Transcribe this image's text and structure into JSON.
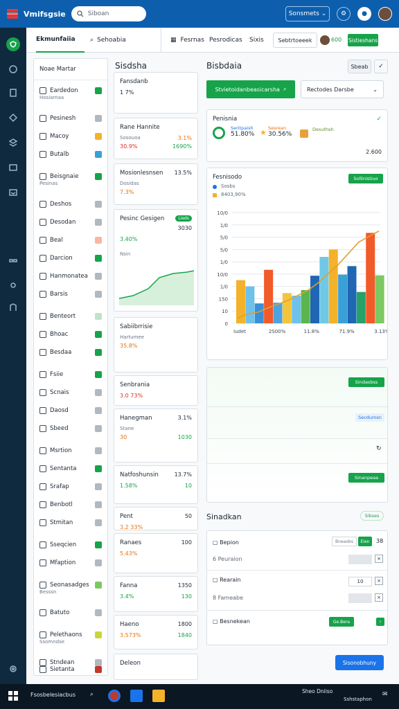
{
  "app": {
    "title": "Vmifsgsie",
    "search_placeholder": "Siboan",
    "btn_label": "Sonsmets"
  },
  "tabs": [
    {
      "label": "Ekmunfaiia"
    },
    {
      "label": "Sehoabia"
    }
  ],
  "toolbar": {
    "items": [
      "Fesrnas",
      "Pesrodicas",
      "Sixis"
    ],
    "select": "Sebtrtoeeek",
    "count": "600",
    "green_btn": "Sistieshans"
  },
  "left_list": {
    "header": "Noae Martar",
    "items": [
      {
        "label": "Eardedon",
        "sub": "Hosiarnaa"
      },
      {
        "label": "Pesinesh"
      },
      {
        "label": "Macoy"
      },
      {
        "label": "Butalb"
      },
      {
        "label": "Beisgnaie",
        "sub": "Pesinas"
      },
      {
        "label": "Deshos"
      },
      {
        "label": "Desodan"
      },
      {
        "label": "Beal"
      },
      {
        "label": "Darcion"
      },
      {
        "label": "Hanmonatea"
      },
      {
        "label": "Barsis"
      },
      {
        "label": "Benteort"
      },
      {
        "label": "Bhoac"
      },
      {
        "label": "Besdaa"
      },
      {
        "label": "Fsiie"
      },
      {
        "label": "Scnais"
      },
      {
        "label": "Daosd"
      },
      {
        "label": "Sbeed"
      },
      {
        "label": "Msrtion"
      },
      {
        "label": "Sentanta"
      },
      {
        "label": "Srafap"
      },
      {
        "label": "Benbotl"
      },
      {
        "label": "Stmitan"
      },
      {
        "label": "Sseqcien"
      },
      {
        "label": "Mfaption"
      },
      {
        "label": "Seonasadges",
        "sub": "Besssn"
      },
      {
        "label": "Batuto"
      },
      {
        "label": "Pelethaons",
        "sub": "Ssomndse"
      },
      {
        "label": "Stndean"
      },
      {
        "label": "Sietanta"
      }
    ]
  },
  "middle": {
    "section_title": "Sisdsha",
    "cards": [
      {
        "title": "Fansdanb",
        "value": "1 7%"
      },
      {
        "title": "Rane Hannite",
        "sub": "Sosouoa",
        "v1": "30.9%",
        "v2": "3.1%",
        "v3": "1690%"
      },
      {
        "title": "Mosionlesnsen",
        "sub": "Dosidas",
        "v1": "7.3%",
        "v2": "13.5%"
      },
      {
        "title": "Pesinc Gesigen",
        "badge": "Lieds",
        "v1": "3030",
        "v2": "3.40%",
        "chart_label": "Nsin"
      },
      {
        "title": "Sabiibrrisie",
        "sub": "Hartumee",
        "v1": "35.8%"
      },
      {
        "title": "Senbrania",
        "v1": "3.0 73%"
      },
      {
        "title": "Hanegman",
        "sub": "Stane",
        "v1": "30",
        "v2": "3.1%",
        "v3": "1030"
      },
      {
        "title": "Natfoshunsin",
        "v1": "1.58%",
        "v2": "13.7%",
        "v3": "10"
      },
      {
        "title": "Pent",
        "v1": "3.2 33%",
        "v2": "50"
      },
      {
        "title": "Ranaes",
        "v1": "5.43%",
        "v2": "100"
      },
      {
        "title": "Fanna",
        "v1": "3.4%",
        "v2": "1350",
        "v3": "130"
      },
      {
        "title": "Haeno",
        "v1": "3.573%",
        "v2": "1800",
        "v3": "1840"
      },
      {
        "title": "Deleon"
      }
    ]
  },
  "right": {
    "title": "Bisbdaia",
    "top_btn": "Sbeab",
    "green_bar": "Stvietoidanbeasicarsha",
    "dropdown": "Rectodes Darsbe",
    "summary": {
      "title": "Penisnia",
      "k1": "Seritpaish",
      "v1": "51.80%",
      "k2": "Sesrean",
      "v2": "30.56%",
      "k3": "Desuthsh",
      "total": "2.600"
    },
    "chart_panel": {
      "title": "Fesnisodo",
      "legend1": "Sosbs",
      "legend2": "8403,90%",
      "btn": "Sollinistiuo"
    },
    "section2": {
      "btn1": "Sindasbss",
      "link": "Secdumsn",
      "btn2": "Sinanpeaa"
    },
    "section3": {
      "title": "Sinadkan",
      "tag": "Sibses",
      "rows": [
        {
          "label": "Bepion",
          "input": "Bneaobs",
          "chip": "Eien",
          "num": "38"
        },
        {
          "label": "Peuraion"
        },
        {
          "label": "Rearain",
          "num": "10"
        },
        {
          "label": "Fameabe"
        },
        {
          "label": "Besnekean",
          "btn": "Ge.Bera"
        }
      ]
    },
    "primary_btn": "Sisonobhuny"
  },
  "chart_data": {
    "type": "bar",
    "categories": [
      "Iudet",
      "2S00%",
      "11.8%",
      "71.9%",
      "3.13%"
    ],
    "series": [
      {
        "color": "#3aa0d8",
        "values": [
          70,
          50,
          40,
          60,
          70,
          15,
          55,
          55,
          80,
          50,
          40,
          45,
          20,
          20,
          38,
          55,
          60,
          55,
          85,
          25
        ]
      }
    ],
    "bars": [
      {
        "v": 1170,
        "c": "#f4b22a"
      },
      {
        "v": 1000,
        "c": "#6ec1ea"
      },
      {
        "v": 540,
        "c": "#3a8fd6"
      },
      {
        "v": 1450,
        "c": "#f15a29"
      },
      {
        "v": 560,
        "c": "#4da3e0"
      },
      {
        "v": 820,
        "c": "#f4c43a"
      },
      {
        "v": 750,
        "c": "#6ec1ea"
      },
      {
        "v": 900,
        "c": "#5ab64c"
      },
      {
        "v": 1290,
        "c": "#1f66b3"
      },
      {
        "v": 1800,
        "c": "#6fc9e6"
      },
      {
        "v": 2000,
        "c": "#f4b22a"
      },
      {
        "v": 1320,
        "c": "#3aa0d8"
      },
      {
        "v": 1550,
        "c": "#1f66b3"
      },
      {
        "v": 850,
        "c": "#26a269"
      },
      {
        "v": 2450,
        "c": "#f15a29"
      },
      {
        "v": 1300,
        "c": "#7dc862"
      }
    ],
    "line": [
      140,
      260,
      300,
      420,
      520,
      620,
      760,
      900,
      1100,
      1350,
      1600,
      1900,
      2200,
      2350,
      2500
    ],
    "yticks": [
      "0",
      "10",
      "150",
      "1/0",
      "10/0",
      "1/0",
      "5/0",
      "5/0",
      "1/0",
      "10/0"
    ],
    "ylim": [
      0,
      3000
    ]
  },
  "taskbar": {
    "text": "Fsosbelesiacbus",
    "time": "Sheo Dniiso",
    "date": "Sshstaphon"
  }
}
